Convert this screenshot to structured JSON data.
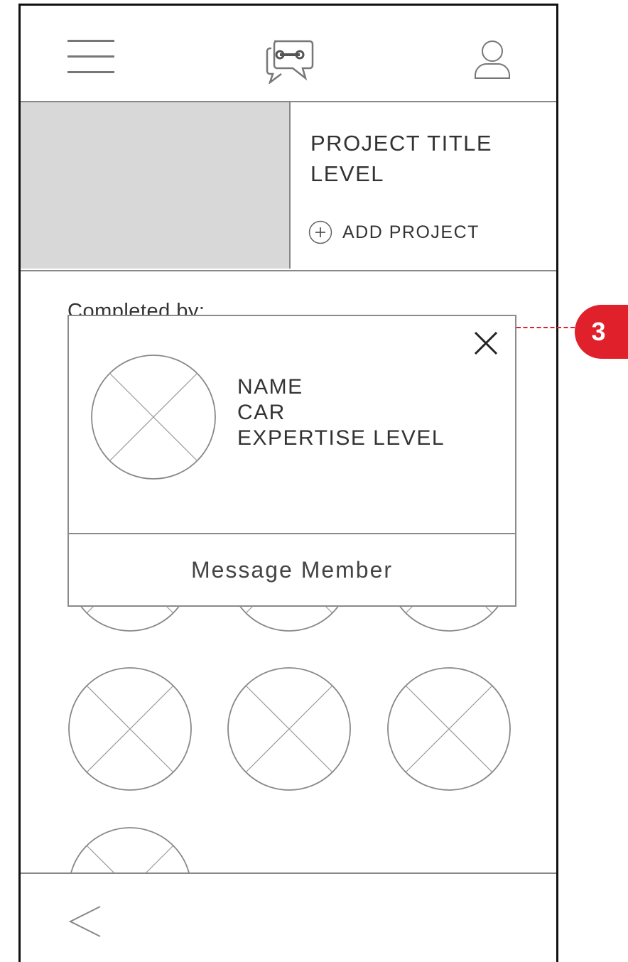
{
  "header": {
    "menu_icon": "hamburger-menu-icon",
    "logo_icon": "chat-wrench-logo-icon",
    "profile_icon": "user-profile-icon"
  },
  "project": {
    "title": "PROJECT TITLE\nLEVEL",
    "add_label": "ADD PROJECT",
    "add_icon": "plus-circle-icon"
  },
  "members": {
    "completed_label": "Completed by:",
    "avatar_placeholder_icon": "image-placeholder-icon"
  },
  "popup": {
    "lines": [
      "NAME",
      "CAR",
      "EXPERTISE LEVEL"
    ],
    "message_label": "Message Member",
    "close_icon": "close-icon"
  },
  "footer": {
    "back_icon": "back-triangle-icon"
  },
  "annotation": {
    "number": "3",
    "color": "#e0202a"
  }
}
